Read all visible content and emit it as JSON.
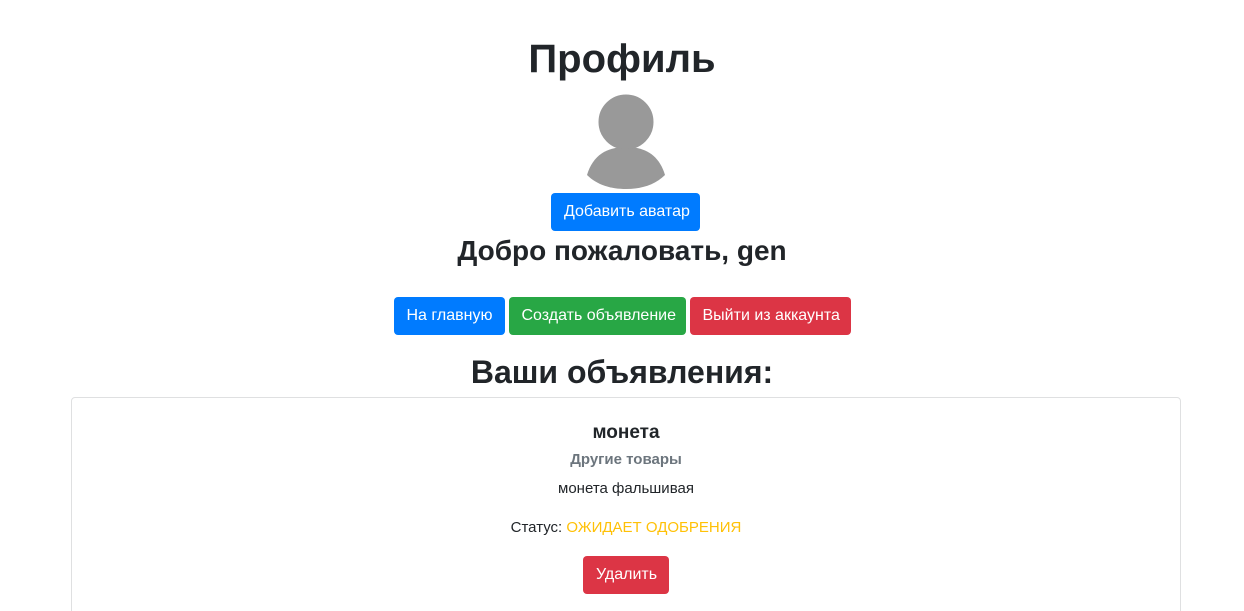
{
  "page": {
    "title": "Профиль"
  },
  "avatar": {
    "icon": "user-silhouette-icon",
    "color": "#999999"
  },
  "buttons": {
    "add_avatar": "Добавить аватар",
    "home": "На главную",
    "create_ad": "Создать объявление",
    "logout": "Выйти из аккаунта"
  },
  "welcome": {
    "prefix": "Добро пожаловать, ",
    "username": "gen"
  },
  "ads": {
    "heading": "Ваши объявления:",
    "items": [
      {
        "title": "монета",
        "category": "Другие товары",
        "description": "монета фальшивая",
        "status_label": "Статус: ",
        "status_value": "ОЖИДАЕТ ОДОБРЕНИЯ",
        "delete_label": "Удалить"
      }
    ]
  },
  "colors": {
    "primary": "#007bff",
    "success": "#28a745",
    "danger": "#dc3545",
    "warning": "#ffc107",
    "muted": "#6c757d"
  }
}
